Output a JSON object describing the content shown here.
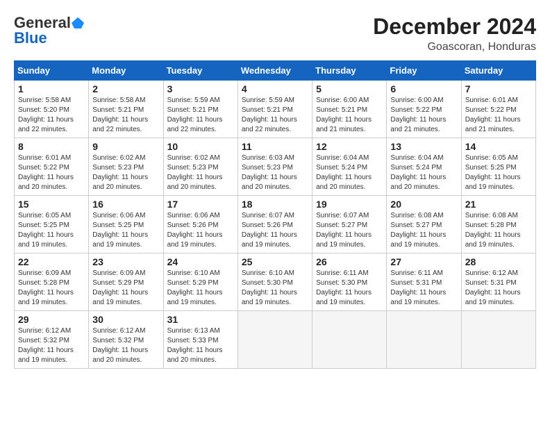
{
  "header": {
    "logo_general": "General",
    "logo_blue": "Blue",
    "title": "December 2024",
    "location": "Goascoran, Honduras"
  },
  "weekdays": [
    "Sunday",
    "Monday",
    "Tuesday",
    "Wednesday",
    "Thursday",
    "Friday",
    "Saturday"
  ],
  "weeks": [
    [
      {
        "day": "1",
        "info": "Sunrise: 5:58 AM\nSunset: 5:20 PM\nDaylight: 11 hours\nand 22 minutes."
      },
      {
        "day": "2",
        "info": "Sunrise: 5:58 AM\nSunset: 5:21 PM\nDaylight: 11 hours\nand 22 minutes."
      },
      {
        "day": "3",
        "info": "Sunrise: 5:59 AM\nSunset: 5:21 PM\nDaylight: 11 hours\nand 22 minutes."
      },
      {
        "day": "4",
        "info": "Sunrise: 5:59 AM\nSunset: 5:21 PM\nDaylight: 11 hours\nand 22 minutes."
      },
      {
        "day": "5",
        "info": "Sunrise: 6:00 AM\nSunset: 5:21 PM\nDaylight: 11 hours\nand 21 minutes."
      },
      {
        "day": "6",
        "info": "Sunrise: 6:00 AM\nSunset: 5:22 PM\nDaylight: 11 hours\nand 21 minutes."
      },
      {
        "day": "7",
        "info": "Sunrise: 6:01 AM\nSunset: 5:22 PM\nDaylight: 11 hours\nand 21 minutes."
      }
    ],
    [
      {
        "day": "8",
        "info": "Sunrise: 6:01 AM\nSunset: 5:22 PM\nDaylight: 11 hours\nand 20 minutes."
      },
      {
        "day": "9",
        "info": "Sunrise: 6:02 AM\nSunset: 5:23 PM\nDaylight: 11 hours\nand 20 minutes."
      },
      {
        "day": "10",
        "info": "Sunrise: 6:02 AM\nSunset: 5:23 PM\nDaylight: 11 hours\nand 20 minutes."
      },
      {
        "day": "11",
        "info": "Sunrise: 6:03 AM\nSunset: 5:23 PM\nDaylight: 11 hours\nand 20 minutes."
      },
      {
        "day": "12",
        "info": "Sunrise: 6:04 AM\nSunset: 5:24 PM\nDaylight: 11 hours\nand 20 minutes."
      },
      {
        "day": "13",
        "info": "Sunrise: 6:04 AM\nSunset: 5:24 PM\nDaylight: 11 hours\nand 20 minutes."
      },
      {
        "day": "14",
        "info": "Sunrise: 6:05 AM\nSunset: 5:25 PM\nDaylight: 11 hours\nand 19 minutes."
      }
    ],
    [
      {
        "day": "15",
        "info": "Sunrise: 6:05 AM\nSunset: 5:25 PM\nDaylight: 11 hours\nand 19 minutes."
      },
      {
        "day": "16",
        "info": "Sunrise: 6:06 AM\nSunset: 5:25 PM\nDaylight: 11 hours\nand 19 minutes."
      },
      {
        "day": "17",
        "info": "Sunrise: 6:06 AM\nSunset: 5:26 PM\nDaylight: 11 hours\nand 19 minutes."
      },
      {
        "day": "18",
        "info": "Sunrise: 6:07 AM\nSunset: 5:26 PM\nDaylight: 11 hours\nand 19 minutes."
      },
      {
        "day": "19",
        "info": "Sunrise: 6:07 AM\nSunset: 5:27 PM\nDaylight: 11 hours\nand 19 minutes."
      },
      {
        "day": "20",
        "info": "Sunrise: 6:08 AM\nSunset: 5:27 PM\nDaylight: 11 hours\nand 19 minutes."
      },
      {
        "day": "21",
        "info": "Sunrise: 6:08 AM\nSunset: 5:28 PM\nDaylight: 11 hours\nand 19 minutes."
      }
    ],
    [
      {
        "day": "22",
        "info": "Sunrise: 6:09 AM\nSunset: 5:28 PM\nDaylight: 11 hours\nand 19 minutes."
      },
      {
        "day": "23",
        "info": "Sunrise: 6:09 AM\nSunset: 5:29 PM\nDaylight: 11 hours\nand 19 minutes."
      },
      {
        "day": "24",
        "info": "Sunrise: 6:10 AM\nSunset: 5:29 PM\nDaylight: 11 hours\nand 19 minutes."
      },
      {
        "day": "25",
        "info": "Sunrise: 6:10 AM\nSunset: 5:30 PM\nDaylight: 11 hours\nand 19 minutes."
      },
      {
        "day": "26",
        "info": "Sunrise: 6:11 AM\nSunset: 5:30 PM\nDaylight: 11 hours\nand 19 minutes."
      },
      {
        "day": "27",
        "info": "Sunrise: 6:11 AM\nSunset: 5:31 PM\nDaylight: 11 hours\nand 19 minutes."
      },
      {
        "day": "28",
        "info": "Sunrise: 6:12 AM\nSunset: 5:31 PM\nDaylight: 11 hours\nand 19 minutes."
      }
    ],
    [
      {
        "day": "29",
        "info": "Sunrise: 6:12 AM\nSunset: 5:32 PM\nDaylight: 11 hours\nand 19 minutes."
      },
      {
        "day": "30",
        "info": "Sunrise: 6:12 AM\nSunset: 5:32 PM\nDaylight: 11 hours\nand 20 minutes."
      },
      {
        "day": "31",
        "info": "Sunrise: 6:13 AM\nSunset: 5:33 PM\nDaylight: 11 hours\nand 20 minutes."
      },
      null,
      null,
      null,
      null
    ]
  ]
}
